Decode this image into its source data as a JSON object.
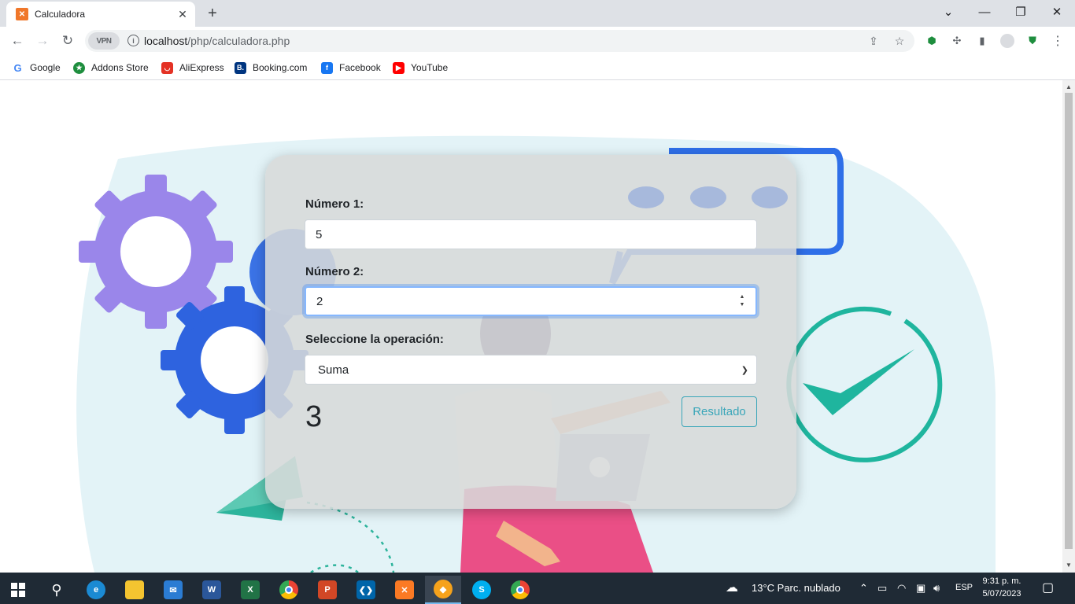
{
  "browser": {
    "tab_title": "Calculadora",
    "tab_icon": "xampp-icon",
    "url_host": "localhost",
    "url_path": "/php/calculadora.php",
    "vpn_label": "VPN",
    "bookmarks": [
      "Google",
      "Addons Store",
      "AliExpress",
      "Booking.com",
      "Facebook",
      "YouTube"
    ]
  },
  "form": {
    "num1_label": "Número 1:",
    "num1_value": "5",
    "num2_label": "Número 2:",
    "num2_value": "2",
    "op_label": "Seleccione la operación:",
    "op_selected": "Suma",
    "result_value": "3",
    "submit_label": "Resultado"
  },
  "taskbar": {
    "weather": "13°C  Parc. nublado",
    "lang": "ESP",
    "time": "9:31 p. m.",
    "date": "5/07/2023",
    "apps": [
      "edge",
      "file-explorer",
      "mail",
      "word",
      "excel",
      "chrome",
      "powerpoint",
      "vscode",
      "xampp",
      "brave",
      "skype",
      "chrome-profile"
    ]
  },
  "colors": {
    "card_bg": "#d7d9da",
    "button_accent": "#3aa6b9",
    "focus_ring": "#86b7fe",
    "taskbar": "#1f2a35"
  }
}
